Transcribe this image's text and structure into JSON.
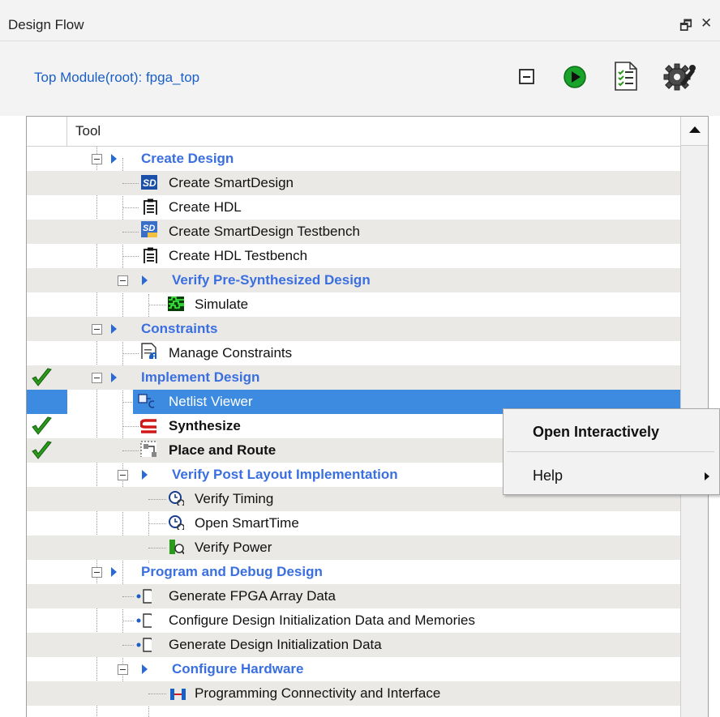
{
  "panel": {
    "title": "Design Flow",
    "float_glyph": "🗗",
    "close_glyph": "✕"
  },
  "toolbar": {
    "top_module_label": "Top Module(root): fpga_top"
  },
  "tree": {
    "column_header": "Tool"
  },
  "rows": [
    {
      "label": "Create Design",
      "type": "category"
    },
    {
      "label": "Create SmartDesign",
      "type": "tool",
      "icon": "smartdesign-icon"
    },
    {
      "label": "Create HDL",
      "type": "tool",
      "icon": "document-icon"
    },
    {
      "label": "Create SmartDesign Testbench",
      "type": "tool",
      "icon": "smartdesign-testbench-icon"
    },
    {
      "label": "Create HDL Testbench",
      "type": "tool",
      "icon": "document-icon"
    },
    {
      "label": "Verify Pre-Synthesized Design",
      "type": "category"
    },
    {
      "label": "Simulate",
      "type": "tool",
      "icon": "waveform-icon"
    },
    {
      "label": "Constraints",
      "type": "category"
    },
    {
      "label": "Manage Constraints",
      "type": "tool",
      "icon": "constraints-info-icon"
    },
    {
      "label": "Implement Design",
      "type": "category"
    },
    {
      "label": "Netlist Viewer",
      "type": "tool",
      "icon": "netlist-viewer-icon"
    },
    {
      "label": "Synthesize",
      "type": "tool",
      "icon": "synthesize-icon"
    },
    {
      "label": "Place and Route",
      "type": "tool",
      "icon": "place-route-icon"
    },
    {
      "label": "Verify Post Layout Implementation",
      "type": "category"
    },
    {
      "label": "Verify Timing",
      "type": "tool",
      "icon": "timing-magnifier-icon"
    },
    {
      "label": "Open SmartTime",
      "type": "tool",
      "icon": "timing-magnifier-icon"
    },
    {
      "label": "Verify Power",
      "type": "tool",
      "icon": "power-magnifier-icon"
    },
    {
      "label": "Program and Debug Design",
      "type": "category"
    },
    {
      "label": "Generate FPGA Array Data",
      "type": "tool",
      "icon": "blank-page-icon"
    },
    {
      "label": "Configure Design Initialization Data and Memories",
      "type": "tool",
      "icon": "blank-page-icon"
    },
    {
      "label": "Generate Design Initialization Data",
      "type": "tool",
      "icon": "blank-page-icon"
    },
    {
      "label": "Configure Hardware",
      "type": "category"
    },
    {
      "label": "Programming Connectivity and Interface",
      "type": "tool",
      "icon": "connectivity-icon"
    }
  ],
  "context_menu": {
    "items": [
      "Open Interactively",
      "Help"
    ]
  },
  "colors": {
    "category": "#3a6fe0",
    "selection": "#3d8be0",
    "check": "#2a9a1a",
    "alt_row": "#ebe9e6"
  }
}
